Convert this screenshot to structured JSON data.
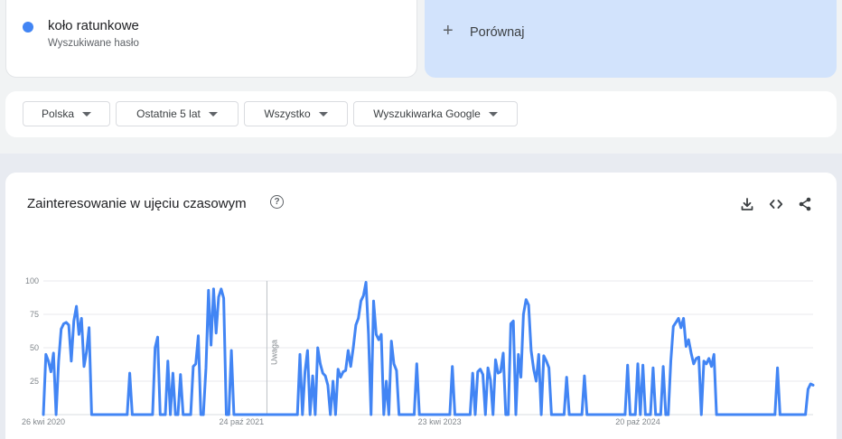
{
  "term": {
    "name": "koło ratunkowe",
    "subtitle": "Wyszukiwane hasło",
    "color": "#4285f4"
  },
  "compare": {
    "label": "Porównaj"
  },
  "filters": [
    {
      "label": "Polska"
    },
    {
      "label": "Ostatnie 5 lat"
    },
    {
      "label": "Wszystko"
    },
    {
      "label": "Wyszukiwarka Google"
    }
  ],
  "chart_section": {
    "title": "Zainteresowanie w ujęciu czasowym",
    "help_icon": "help-circle-icon",
    "actions": [
      "download-icon",
      "embed-code-icon",
      "share-icon"
    ]
  },
  "chart_data": {
    "type": "line",
    "title": "",
    "xlabel": "",
    "ylabel": "",
    "ylim": [
      0,
      100
    ],
    "yticks": [
      "25",
      "50",
      "75",
      "100"
    ],
    "xticks": [
      {
        "label": "26 kwi 2020",
        "x": 0
      },
      {
        "label": "24 paź 2021",
        "x": 78
      },
      {
        "label": "23 kwi 2023",
        "x": 156
      },
      {
        "label": "20 paź 2024",
        "x": 234
      }
    ],
    "note": {
      "label": "Uwaga",
      "x": 88
    },
    "color": "#4285f4",
    "grid": true,
    "series": [
      {
        "values": [
          0,
          45,
          40,
          32,
          46,
          0,
          40,
          64,
          68,
          69,
          67,
          40,
          70,
          81,
          60,
          72,
          36,
          47,
          65,
          0,
          0,
          0,
          0,
          0,
          0,
          0,
          0,
          0,
          0,
          0,
          0,
          0,
          0,
          0,
          31,
          0,
          0,
          0,
          0,
          0,
          0,
          0,
          0,
          0,
          50,
          58,
          0,
          0,
          0,
          40,
          0,
          31,
          0,
          0,
          30,
          0,
          0,
          0,
          0,
          36,
          38,
          59,
          0,
          0,
          35,
          93,
          52,
          94,
          61,
          88,
          94,
          87,
          0,
          0,
          48,
          0,
          0,
          0,
          0,
          0,
          0,
          0,
          0,
          0,
          0,
          0,
          0,
          0,
          0,
          0,
          0,
          0,
          0,
          0,
          0,
          0,
          0,
          0,
          0,
          0,
          0,
          45,
          0,
          32,
          48,
          0,
          29,
          0,
          50,
          38,
          31,
          29,
          22,
          0,
          25,
          0,
          34,
          28,
          32,
          33,
          48,
          36,
          50,
          67,
          72,
          85,
          89,
          99,
          60,
          0,
          85,
          60,
          56,
          60,
          0,
          25,
          0,
          55,
          38,
          33,
          0,
          0,
          0,
          0,
          0,
          0,
          0,
          38,
          0,
          0,
          0,
          0,
          0,
          0,
          0,
          0,
          0,
          0,
          0,
          0,
          0,
          36,
          0,
          0,
          0,
          0,
          0,
          0,
          0,
          31,
          0,
          32,
          34,
          30,
          0,
          35,
          26,
          0,
          41,
          31,
          32,
          46,
          0,
          0,
          68,
          70,
          0,
          45,
          28,
          75,
          86,
          82,
          48,
          34,
          25,
          45,
          0,
          44,
          40,
          35,
          0,
          0,
          0,
          0,
          0,
          0,
          28,
          0,
          0,
          0,
          0,
          0,
          0,
          29,
          0,
          0,
          0,
          0,
          0,
          0,
          0,
          0,
          0,
          0,
          0,
          0,
          0,
          0,
          0,
          0,
          37,
          0,
          0,
          0,
          38,
          0,
          37,
          0,
          0,
          0,
          35,
          0,
          0,
          0,
          36,
          0,
          0,
          40,
          66,
          69,
          72,
          65,
          72,
          51,
          56,
          46,
          38,
          42,
          43,
          0,
          40,
          38,
          42,
          36,
          45,
          0,
          0,
          0,
          0,
          0,
          0,
          0,
          0,
          0,
          0,
          0,
          0,
          0,
          0,
          0,
          0,
          0,
          0,
          0,
          0,
          0,
          0,
          0,
          0,
          35,
          0,
          0,
          0,
          0,
          0,
          0,
          0,
          0,
          0,
          0,
          0,
          19,
          23,
          22
        ]
      }
    ]
  }
}
